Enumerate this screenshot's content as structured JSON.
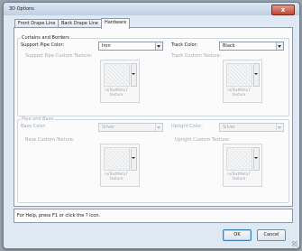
{
  "window": {
    "title": "3D Options",
    "close_label": "x"
  },
  "tabs": [
    {
      "label": "Front Drape Line",
      "active": false
    },
    {
      "label": "Back Drape Line",
      "active": false
    },
    {
      "label": "Hardware",
      "active": true
    }
  ],
  "curtains": {
    "group_title": "Curtains and Borders",
    "support_pipe_color_label": "Support Pipe Color:",
    "support_pipe_color_value": "Iron",
    "track_color_label": "Track Color:",
    "track_color_value": "Black",
    "support_pipe_texture_label": "Support Pipe Custom Texture:",
    "track_texture_label": "Track Custom Texture:",
    "texture_placeholder": "noTextMeta7 texture"
  },
  "pipe_base": {
    "group_title": "Pipe and Base",
    "base_color_label": "Base Color:",
    "base_color_value": "Silver",
    "upright_color_label": "Upright Color:",
    "upright_color_value": "Silver",
    "base_texture_label": "Base Custom Texture:",
    "upright_texture_label": "Upright Custom Texture:",
    "texture_placeholder": "noTextMeta7 texture"
  },
  "help_text": "For Help, press F1 or click the ? icon.",
  "buttons": {
    "ok": "OK",
    "cancel": "Cancel"
  }
}
